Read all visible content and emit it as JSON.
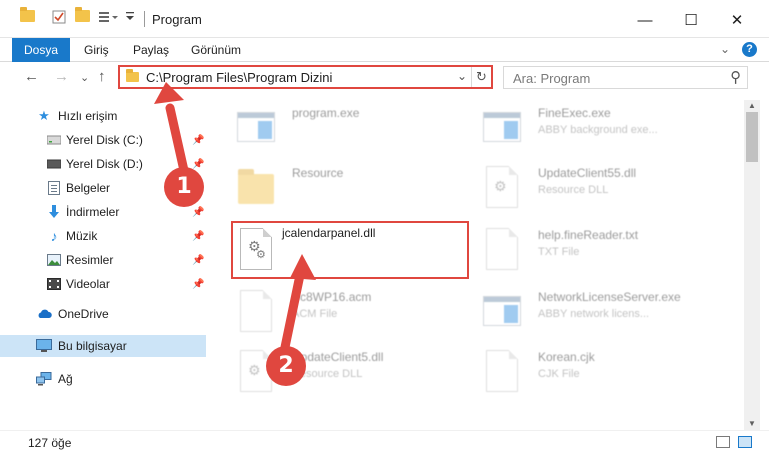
{
  "window": {
    "title": "Program",
    "minimize_glyph": "—",
    "maximize_glyph": "☐",
    "close_glyph": "✕"
  },
  "ribbon": {
    "tabs": [
      "Dosya",
      "Giriş",
      "Paylaş",
      "Görünüm"
    ],
    "expand_glyph": "⌄",
    "help_glyph": "?"
  },
  "address": {
    "path": "C:\\Program Files\\Program Dizini",
    "back_glyph": "←",
    "forward_glyph": "→",
    "recent_glyph": "⌄",
    "up_glyph": "↑",
    "dropdown_glyph": "⌄",
    "refresh_glyph": "↻"
  },
  "search": {
    "placeholder": "Ara: Program",
    "icon": "⚲"
  },
  "nav": {
    "quick_access": "Hızlı erişim",
    "items": [
      {
        "label": "Yerel Disk (C:)",
        "icon": "drive-icon",
        "pinned": true
      },
      {
        "label": "Yerel Disk (D:)",
        "icon": "drive-icon",
        "pinned": true
      },
      {
        "label": "Belgeler",
        "icon": "documents-icon",
        "pinned": true
      },
      {
        "label": "İndirmeler",
        "icon": "download-icon",
        "pinned": true
      },
      {
        "label": "Müzik",
        "icon": "music-icon",
        "pinned": true
      },
      {
        "label": "Resimler",
        "icon": "pictures-icon",
        "pinned": true
      },
      {
        "label": "Videolar",
        "icon": "videos-icon",
        "pinned": true
      }
    ],
    "onedrive": "OneDrive",
    "this_pc": "Bu bilgisayar",
    "network": "Ağ",
    "pin_glyph": "📌"
  },
  "files": {
    "left": [
      {
        "name": "program.exe",
        "desc": "",
        "type": "exe"
      },
      {
        "name": "Resource",
        "desc": "",
        "type": "folder"
      },
      {
        "name": "jcalendarpanel.dll",
        "desc": "",
        "type": "dll"
      },
      {
        "name": "Sc8WP16.acm",
        "desc": "ACM File",
        "type": "doc"
      },
      {
        "name": "UpdateClient5.dll",
        "desc": "Resource DLL",
        "type": "dll"
      }
    ],
    "right": [
      {
        "name": "FineExec.exe",
        "desc": "ABBY background exe...",
        "type": "exe"
      },
      {
        "name": "UpdateClient55.dll",
        "desc": "Resource DLL",
        "type": "dll"
      },
      {
        "name": "help.fineReader.txt",
        "desc": "TXT File",
        "type": "doc"
      },
      {
        "name": "NetworkLicenseServer.exe",
        "desc": "ABBY network licens...",
        "type": "exe"
      },
      {
        "name": "Korean.cjk",
        "desc": "CJK File",
        "type": "doc"
      }
    ]
  },
  "status": {
    "item_count": "127 öğe"
  },
  "annotations": {
    "step1": "1",
    "step2": "2"
  },
  "colors": {
    "accent": "#1979ca",
    "highlight": "#e0473f",
    "selection": "#cce4f7",
    "folder": "#f3c34a"
  }
}
